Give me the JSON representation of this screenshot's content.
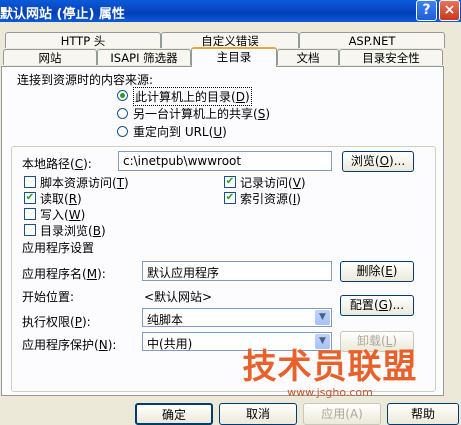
{
  "window": {
    "title": "默认网站 (停止) 属性",
    "help_label": "?",
    "close_label": "×"
  },
  "tabs_row1": [
    "HTTP 头",
    "自定义错误",
    "ASP.NET"
  ],
  "tabs_row2": [
    "网站",
    "ISAPI 筛选器",
    "主目录",
    "文档",
    "目录安全性"
  ],
  "active_tab": "主目录",
  "content_source": {
    "label": "连接到资源时的内容来源:",
    "options": [
      {
        "label": "此计算机上的目录",
        "key": "D",
        "selected": true
      },
      {
        "label": "另一台计算机上的共享",
        "key": "S",
        "selected": false
      },
      {
        "label": "重定向到 URL",
        "key": "U",
        "selected": false
      }
    ]
  },
  "local_path": {
    "label": "本地路径",
    "key": "C",
    "value": "c:\\inetpub\\wwwroot",
    "browse_label": "浏览",
    "browse_key": "O"
  },
  "permissions": {
    "script_source_access": {
      "label": "脚本资源访问",
      "key": "T",
      "checked": false
    },
    "read": {
      "label": "读取",
      "key": "R",
      "checked": true
    },
    "write": {
      "label": "写入",
      "key": "W",
      "checked": false
    },
    "directory_browsing": {
      "label": "目录浏览",
      "key": "B",
      "checked": false
    },
    "log_visits": {
      "label": "记录访问",
      "key": "V",
      "checked": true
    },
    "index_resource": {
      "label": "索引资源",
      "key": "I",
      "checked": true
    }
  },
  "app_settings": {
    "section_label": "应用程序设置",
    "app_name_label": "应用程序名",
    "app_name_key": "M",
    "app_name_value": "默认应用程序",
    "remove_label": "删除",
    "remove_key": "E",
    "start_point_label": "开始位置:",
    "start_point_value": "<默认网站>",
    "config_label": "配置",
    "config_key": "G",
    "exec_perm_label": "执行权限",
    "exec_perm_key": "P",
    "exec_perm_value": "纯脚本",
    "app_protection_label": "应用程序保护",
    "app_protection_key": "N",
    "app_protection_value": "中(共用)",
    "unload_label": "卸载",
    "unload_key": "L"
  },
  "footer_buttons": [
    "确定",
    "取消",
    "应用(A)",
    "帮助"
  ],
  "watermark": {
    "text": "技术员联盟",
    "url": "www.jsgho.com"
  },
  "colors": {
    "title_bar": "#0a5bd8",
    "window_bg": "#ece9d8",
    "check_green": "#21a121",
    "active_tab_accent": "#e8a83f",
    "watermark_orange": "#e8602a"
  }
}
